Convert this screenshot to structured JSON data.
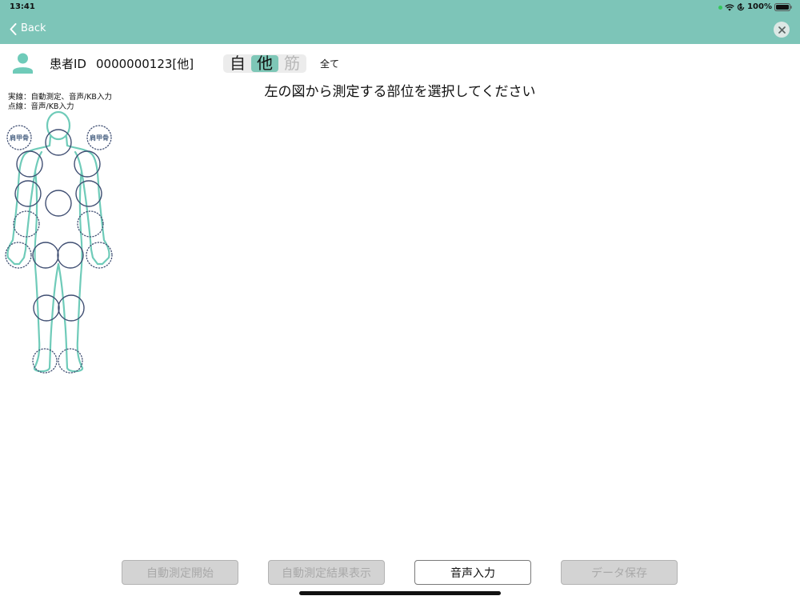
{
  "status_bar": {
    "time": "13:41",
    "battery": "100%"
  },
  "header": {
    "back_label": "Back"
  },
  "patient": {
    "id_label": "患者ID",
    "id_value": "0000000123[他]"
  },
  "mode_segment": {
    "options": [
      {
        "label": "自",
        "selected": false,
        "enabled": true
      },
      {
        "label": "他",
        "selected": true,
        "enabled": true
      },
      {
        "label": "筋",
        "selected": false,
        "enabled": false
      }
    ]
  },
  "filter_all_label": "全て",
  "legend": {
    "solid": "実線：自動測定、音声/KB入力",
    "dotted": "点線：音声/KB入力"
  },
  "body_map": {
    "scapula_labels": [
      "肩甲骨",
      "肩甲骨"
    ]
  },
  "instruction": "左の図から測定する部位を選択してください",
  "actions": [
    {
      "label": "自動測定開始",
      "enabled": false
    },
    {
      "label": "自動測定結果表示",
      "enabled": false
    },
    {
      "label": "音声入力",
      "enabled": true
    },
    {
      "label": "データ保存",
      "enabled": false
    }
  ],
  "colors": {
    "header_bg": "#7dc5b8",
    "accent": "#6fcbb9",
    "segment_selected": "#7ec7b7",
    "joint_circle": "#3f4e72",
    "disabled_button_bg": "#d3d3d3",
    "indicator_green": "#34c759"
  },
  "icons": {
    "back": "chevron-left-icon",
    "close": "close-icon",
    "patient": "person-icon",
    "wifi": "wifi-icon",
    "orientation_lock": "rotation-lock-icon",
    "battery": "battery-icon"
  }
}
